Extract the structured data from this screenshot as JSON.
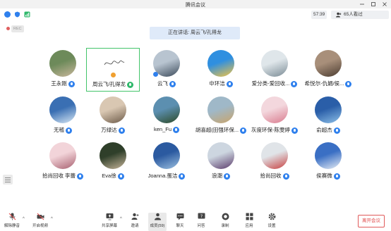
{
  "window": {
    "title": "腾讯会议"
  },
  "status": {
    "timer": "57:39",
    "participants": "65人看过"
  },
  "recording": {
    "label": "REC"
  },
  "banner": {
    "speaking": "正在讲话: 周云飞/孔得龙"
  },
  "colors": {
    "mic_blue": "#2f80ed",
    "active_green": "#43c46a",
    "leave_red": "#e04848"
  },
  "participants": [
    {
      "name": "王永刚",
      "mic": "blue"
    },
    {
      "name": "周云飞/孔得龙",
      "mic": "green",
      "active": true
    },
    {
      "name": "云飞",
      "mic": "blue"
    },
    {
      "name": "中环洁",
      "mic": "blue"
    },
    {
      "name": "爱分类-爱回收...",
      "mic": "blue"
    },
    {
      "name": "希悦尔-仇娟/侯...",
      "mic": "blue"
    },
    {
      "name": "无稽",
      "mic": "blue"
    },
    {
      "name": "万绿达",
      "mic": "blue"
    },
    {
      "name": "ken_Fu",
      "mic": "blue"
    },
    {
      "name": "胡喜超(田强环保...",
      "mic": "blue"
    },
    {
      "name": "灰度环保-陈雯婷",
      "mic": "blue"
    },
    {
      "name": "俞超杰",
      "mic": "blue"
    },
    {
      "name": "拾尚回收 李蕾",
      "mic": "blue"
    },
    {
      "name": "Eva徐",
      "mic": "blue"
    },
    {
      "name": "Joanna.蛋洁",
      "mic": "blue"
    },
    {
      "name": "浪潮",
      "mic": "blue"
    },
    {
      "name": "拾尚回收",
      "mic": "blue"
    },
    {
      "name": "侯赛微",
      "mic": "blue"
    }
  ],
  "toolbar": {
    "mute": "解除静音",
    "video": "开启视频",
    "share": "共享屏幕",
    "invite": "邀请",
    "members": "成员(59)",
    "chat": "聊天",
    "qa": "问答",
    "record": "录制",
    "apps": "应用",
    "settings": "设置",
    "leave": "离开会议"
  }
}
